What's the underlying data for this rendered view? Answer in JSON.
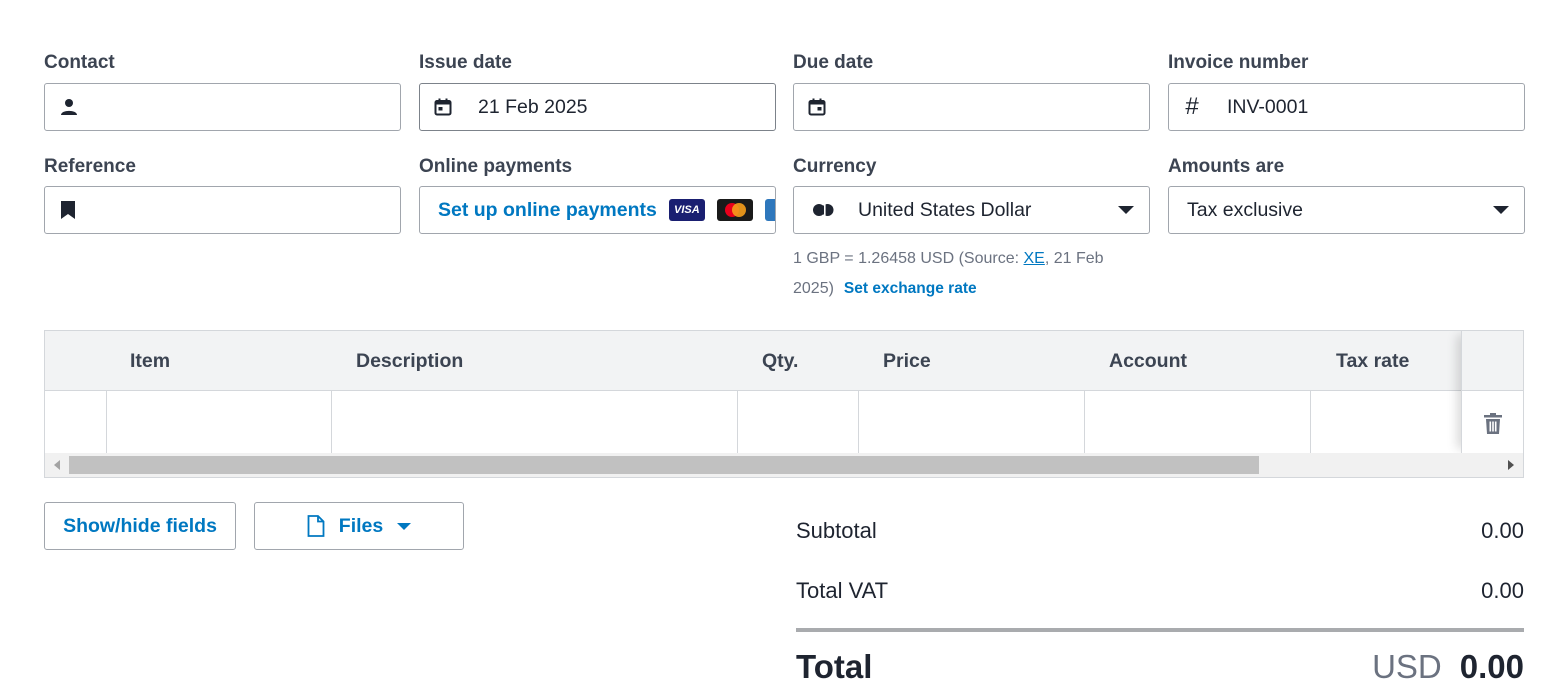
{
  "fields": {
    "contact": {
      "label": "Contact",
      "value": "",
      "icon": "person-icon"
    },
    "issue_date": {
      "label": "Issue date",
      "value": "21 Feb 2025",
      "icon": "calendar-icon"
    },
    "due_date": {
      "label": "Due date",
      "value": "",
      "icon": "calendar-icon"
    },
    "invoice_number": {
      "label": "Invoice number",
      "value": "INV-0001",
      "icon": "hash-icon"
    },
    "reference": {
      "label": "Reference",
      "value": "",
      "icon": "bookmark-icon"
    },
    "online_payments": {
      "label": "Online payments",
      "link": "Set up online payments",
      "cards": [
        "VISA",
        "mastercard",
        "amex"
      ]
    },
    "currency": {
      "label": "Currency",
      "value": "United States Dollar",
      "icon": "currency-dots-icon"
    },
    "amounts_are": {
      "label": "Amounts are",
      "value": "Tax exclusive"
    }
  },
  "exchange": {
    "prefix": "1 GBP = 1.26458 USD (Source: ",
    "source_link": "XE",
    "suffix": ", 21 Feb 2025)",
    "set_rate": "Set exchange rate"
  },
  "table": {
    "columns": [
      "Item",
      "Description",
      "Qty.",
      "Price",
      "Account",
      "Tax rate"
    ],
    "rows": [
      {
        "item": "",
        "description": "",
        "qty": "",
        "price": "",
        "account": "",
        "tax_rate": ""
      }
    ]
  },
  "buttons": {
    "show_hide": "Show/hide fields",
    "files": "Files"
  },
  "totals": {
    "subtotal_label": "Subtotal",
    "subtotal_value": "0.00",
    "vat_label": "Total VAT",
    "vat_value": "0.00",
    "total_label": "Total",
    "total_currency": "USD",
    "total_value": "0.00"
  },
  "colors": {
    "accent": "#0078c1",
    "text": "#1e2430",
    "muted": "#6b7280",
    "border": "#a1a6ad"
  }
}
